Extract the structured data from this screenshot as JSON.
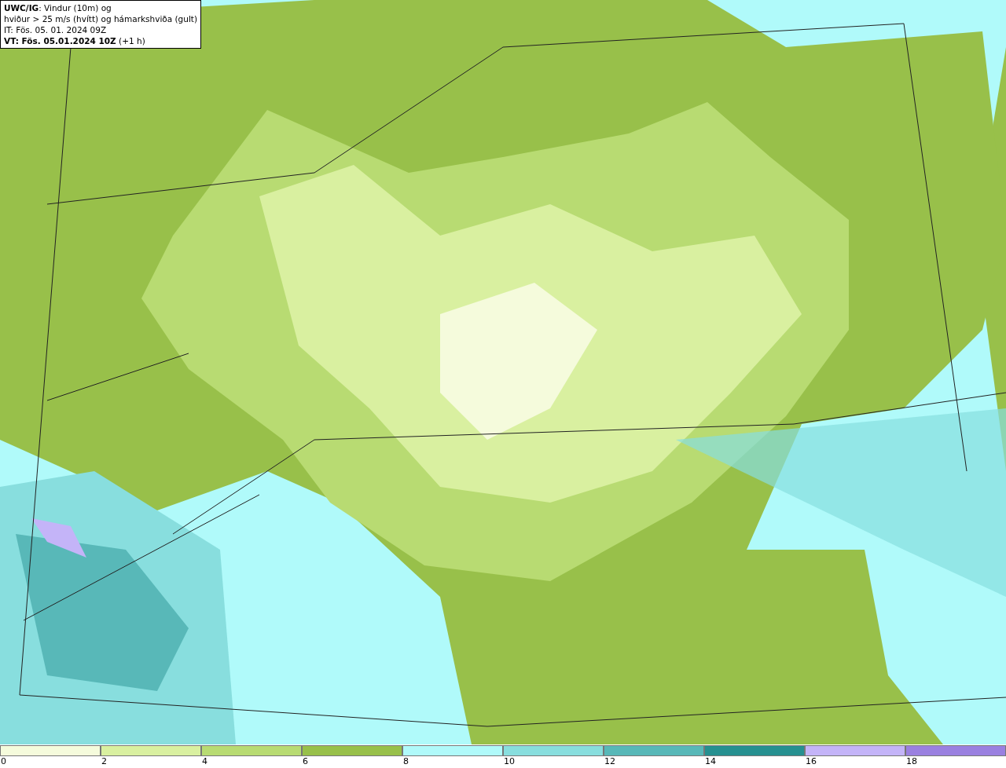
{
  "title_box": {
    "lines": [
      "**UWC/IG**: Vindur (10m) og",
      "hviður > 25 m/s (hvítt) og hámarkshviða (gult)",
      "IT: Fös. 05. 01. 2024 09Z",
      "**VT: Fös. 05.01.2024 10Z** (+1 h)"
    ]
  },
  "legend": [
    {
      "label": "0",
      "color": "#f5fbdc"
    },
    {
      "label": "2",
      "color": "#d9f0a0"
    },
    {
      "label": "4",
      "color": "#b8db72"
    },
    {
      "label": "6",
      "color": "#98c04a"
    },
    {
      "label": "8",
      "color": "#b0fafa"
    },
    {
      "label": "10",
      "color": "#88dede"
    },
    {
      "label": "12",
      "color": "#58b8b8"
    },
    {
      "label": "14",
      "color": "#269090"
    },
    {
      "label": "16",
      "color": "#c4b4f8"
    },
    {
      "label": "18",
      "color": "#9a80e0"
    }
  ]
}
